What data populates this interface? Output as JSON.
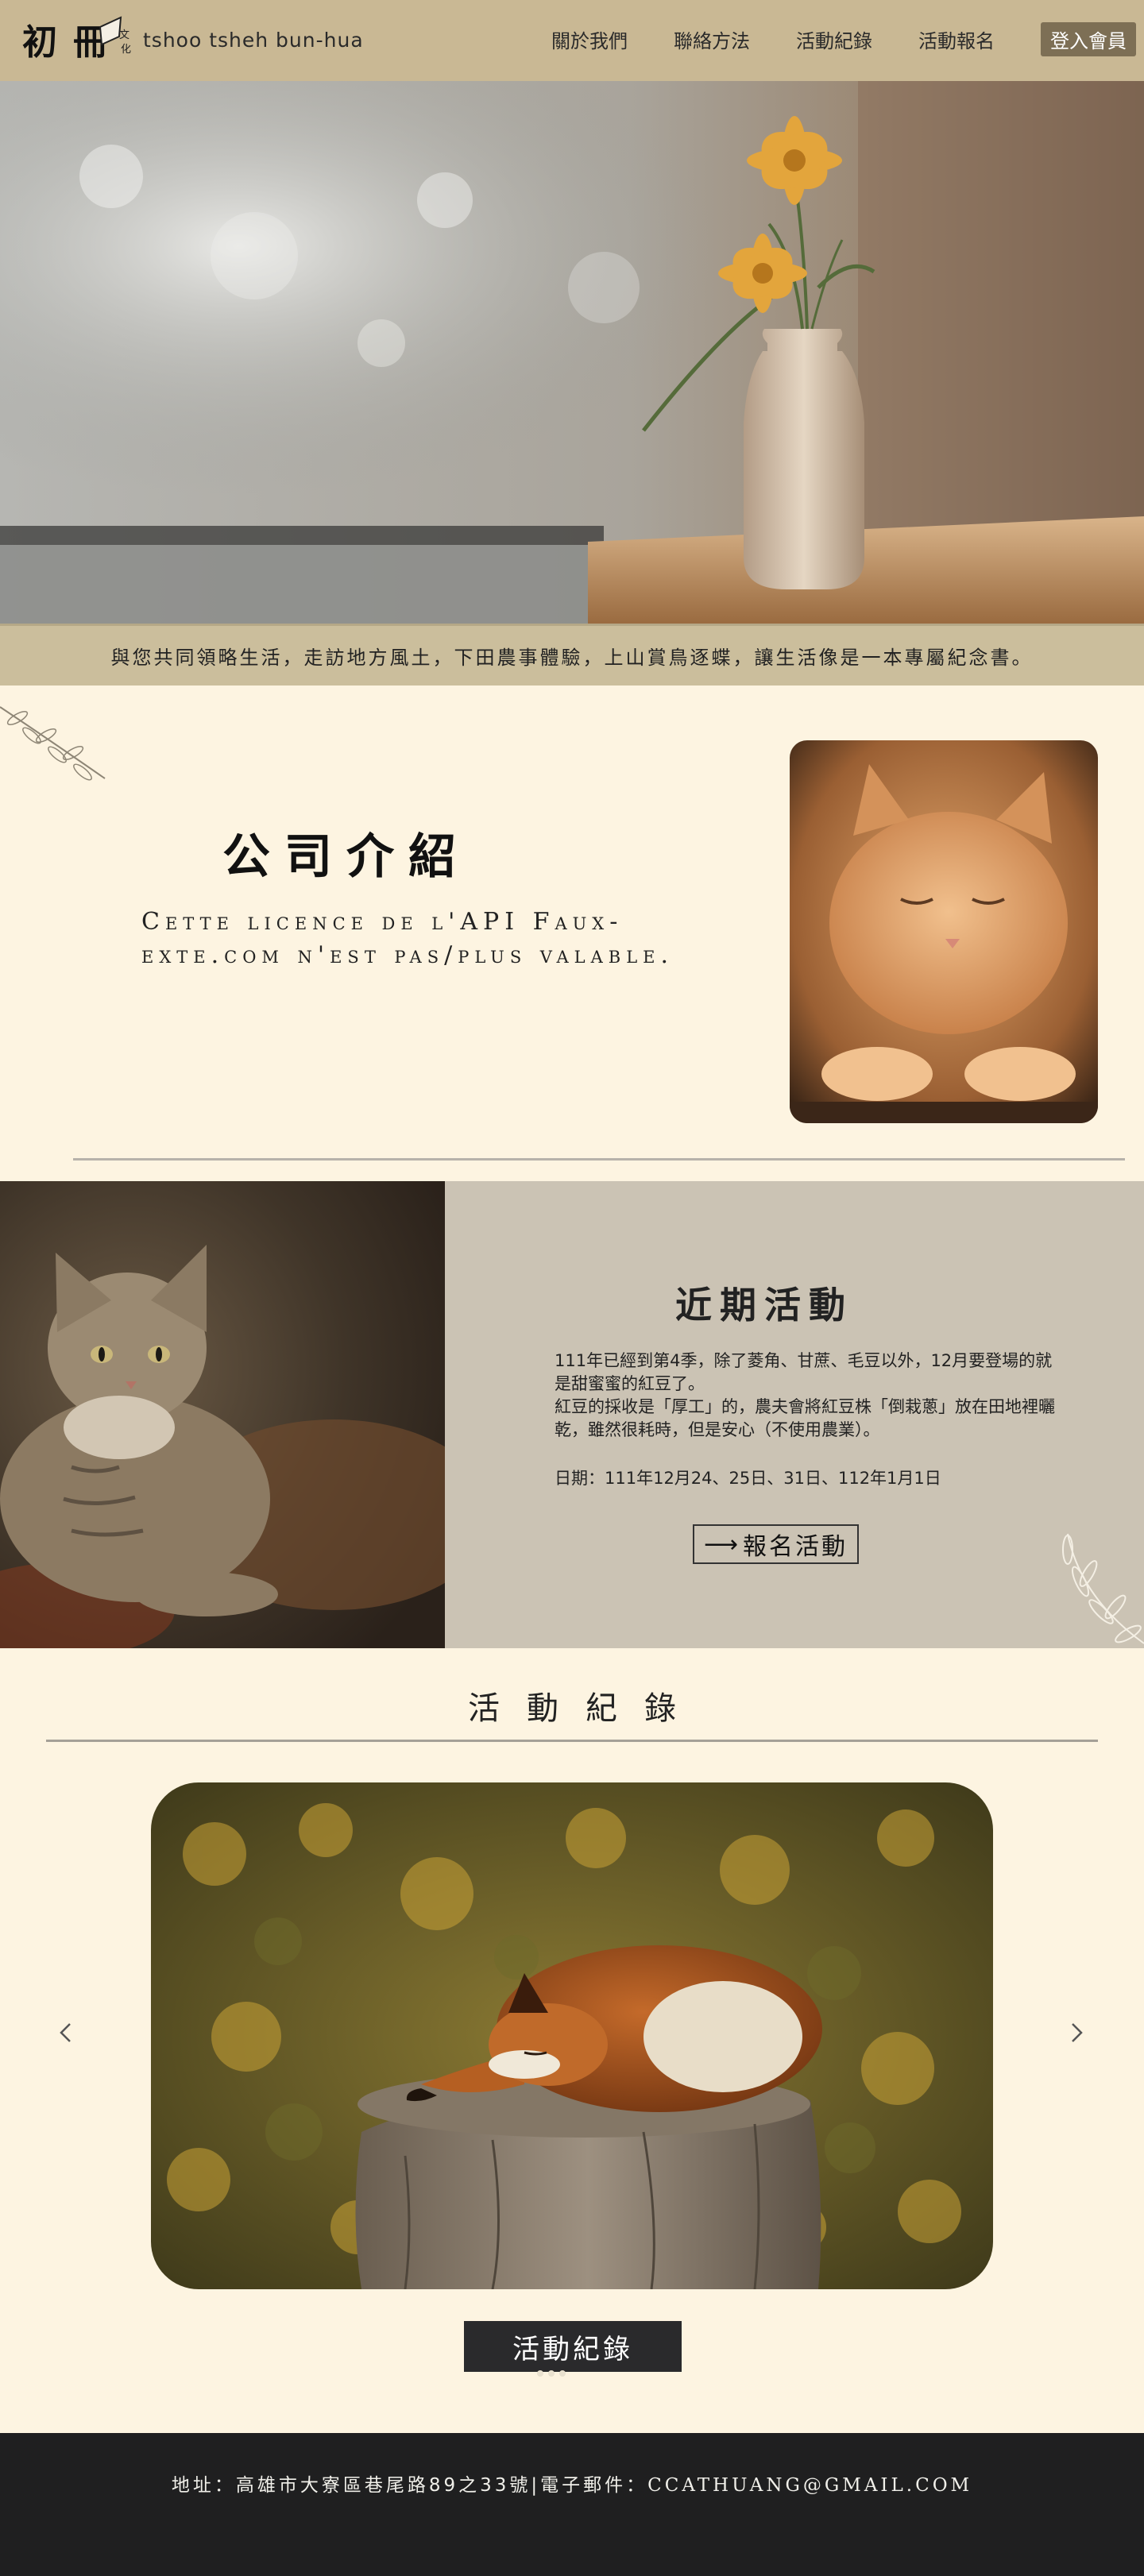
{
  "header": {
    "logo_text": "初冊",
    "brand_sub": "tshoo tsheh bun-hua",
    "nav": [
      "關於我們",
      "聯絡方法",
      "活動紀錄",
      "活動報名"
    ],
    "login": "登入會員"
  },
  "hero": {
    "tagline": "與您共同領略生活，走訪地方風土，下田農事體驗，上山賞鳥逐蝶，讓生活像是一本專屬紀念書。"
  },
  "intro": {
    "title": "公司介紹",
    "desc": "Cette licence de l'API Faux-exte.com n'est pas/plus valable."
  },
  "event": {
    "title": "近期活動",
    "para1": "111年已經到第4季，除了菱角、甘蔗、毛豆以外，12月要登場的就是甜蜜蜜的紅豆了。",
    "para2": "紅豆的採收是「厚工」的，農夫會將紅豆株「倒栽蔥」放在田地裡曬乾，雖然很耗時，但是安心（不使用農業）。",
    "date": "日期：111年12月24、25日、31日、112年1月1日",
    "button": "報名活動"
  },
  "records": {
    "title": "活動紀錄",
    "button": "活動紀錄"
  },
  "footer": {
    "address": "地址：高雄市大寮區巷尾路89之33號",
    "separator": "|",
    "email_label": "電子郵件：",
    "email": "CCATHUANG@GMAIL.COM"
  }
}
